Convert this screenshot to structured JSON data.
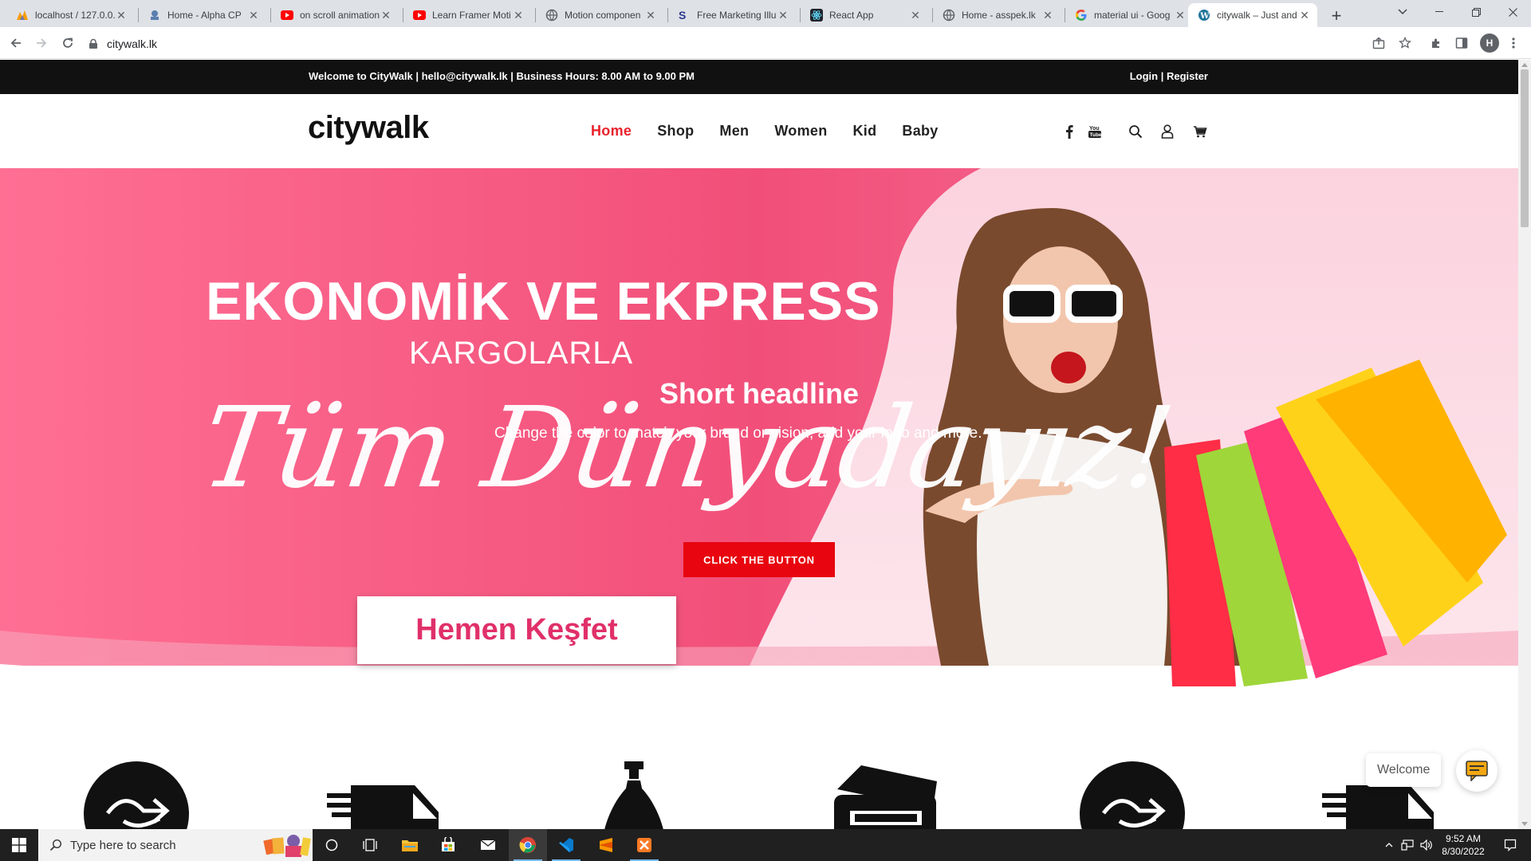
{
  "browser": {
    "tabs": [
      {
        "title": "localhost / 127.0.0.",
        "icon": "phpmyadmin-icon"
      },
      {
        "title": "Home - Alpha CP",
        "icon": "alpha-icon"
      },
      {
        "title": "on scroll animation",
        "icon": "youtube-icon"
      },
      {
        "title": "Learn Framer Moti",
        "icon": "youtube-icon"
      },
      {
        "title": "Motion componen",
        "icon": "globe-icon"
      },
      {
        "title": "Free Marketing Illu",
        "icon": "storyset-icon"
      },
      {
        "title": "React App",
        "icon": "react-icon"
      },
      {
        "title": "Home - asspek.lk",
        "icon": "globe-icon"
      },
      {
        "title": "material ui - Goog",
        "icon": "google-icon"
      },
      {
        "title": "citywalk – Just and",
        "icon": "wordpress-icon"
      }
    ],
    "url": "citywalk.lk",
    "profile_initial": "H"
  },
  "site": {
    "topbar": {
      "welcome": "Welcome to CityWalk | hello@citywalk.lk | Business Hours: 8.00 AM to 9.00 PM",
      "login": "Login",
      "separator": " | ",
      "register": "Register"
    },
    "logo": "citywalk",
    "nav": [
      "Home",
      "Shop",
      "Men",
      "Women",
      "Kid",
      "Baby"
    ],
    "hero": {
      "banner_title": "EKONOMİK VE EKPRESS",
      "banner_subtitle": "KARGOLARLA",
      "banner_script": "Tüm Dünyadayız!",
      "headline": "Short headline",
      "subtext": "Change the color to match your brand or vision, add your logo and more.",
      "cta": "CLICK THE BUTTON",
      "explore": "Hemen Keşfet"
    },
    "chat": {
      "label": "Welcome"
    }
  },
  "taskbar": {
    "search_placeholder": "Type here to search",
    "time": "9:52 AM",
    "date": "8/30/2022"
  },
  "colors": {
    "accent": "#e8222c",
    "cta": "#e8050f",
    "hero_pink": "#f2557a",
    "explore_text": "#e0306a"
  }
}
